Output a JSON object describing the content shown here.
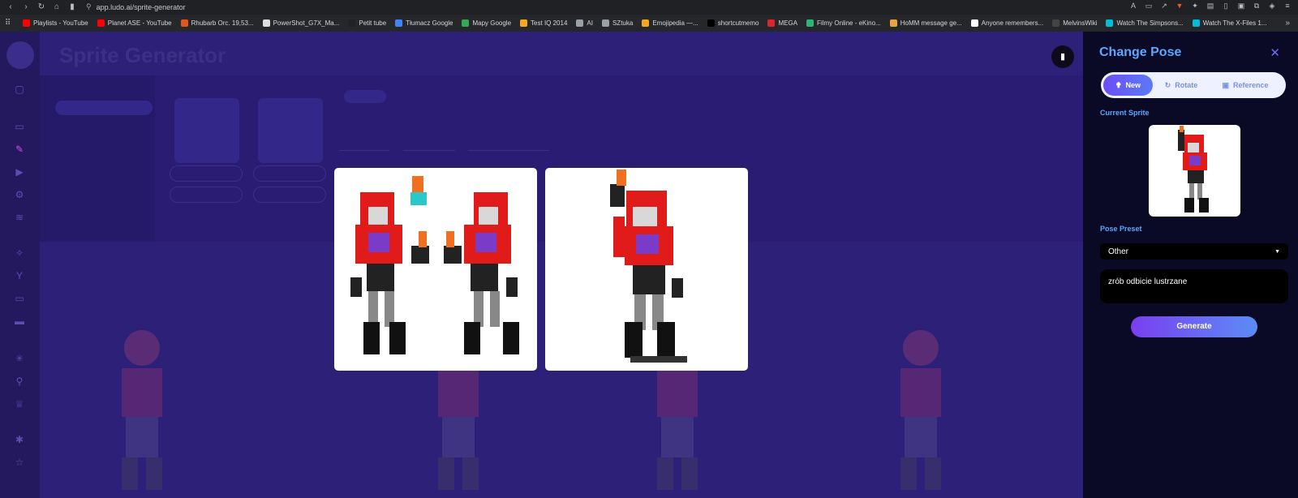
{
  "browser": {
    "url": "app.ludo.ai/sprite-generator",
    "bookmarks": [
      {
        "label": "Playlists - YouTube",
        "color": "#ff0000"
      },
      {
        "label": "Planet ASE - YouTube",
        "color": "#ff0000"
      },
      {
        "label": "Rhubarb Orc. 19,53...",
        "color": "#e0561b"
      },
      {
        "label": "PowerShot_G7X_Ma...",
        "color": "#dddddd"
      },
      {
        "label": "Petit tube",
        "color": "#222222"
      },
      {
        "label": "Tłumacz Google",
        "color": "#4285f4"
      },
      {
        "label": "Mapy Google",
        "color": "#34a853"
      },
      {
        "label": "Test IQ 2014",
        "color": "#f5a623"
      },
      {
        "label": "AI",
        "color": "#9aa0a6"
      },
      {
        "label": "SZtuka",
        "color": "#9aa0a6"
      },
      {
        "label": "Emojipedia —...",
        "color": "#f5a623"
      },
      {
        "label": "shortcutmemo",
        "color": "#000000"
      },
      {
        "label": "MEGA",
        "color": "#d9272e"
      },
      {
        "label": "Filmy Online - eKino...",
        "color": "#2bb673"
      },
      {
        "label": "HoMM message ge...",
        "color": "#e8a33c"
      },
      {
        "label": "Anyone remembers...",
        "color": "#ffffff"
      },
      {
        "label": "MelvinsWiki",
        "color": "#444444"
      },
      {
        "label": "Watch The Simpsons...",
        "color": "#00bcd4"
      },
      {
        "label": "Watch The X-Files 1...",
        "color": "#00bcd4"
      }
    ]
  },
  "app": {
    "title": "Sprite Generator"
  },
  "panel": {
    "title": "Change Pose",
    "tabs": [
      {
        "label": "New",
        "icon": "pose-icon"
      },
      {
        "label": "Rotate",
        "icon": "rotate-icon"
      },
      {
        "label": "Reference",
        "icon": "image-icon"
      }
    ],
    "current_sprite_label": "Current Sprite",
    "pose_preset_label": "Pose Preset",
    "pose_preset_value": "Other",
    "prompt_value": "zrób odbicie lustrzane",
    "generate_label": "Generate"
  }
}
